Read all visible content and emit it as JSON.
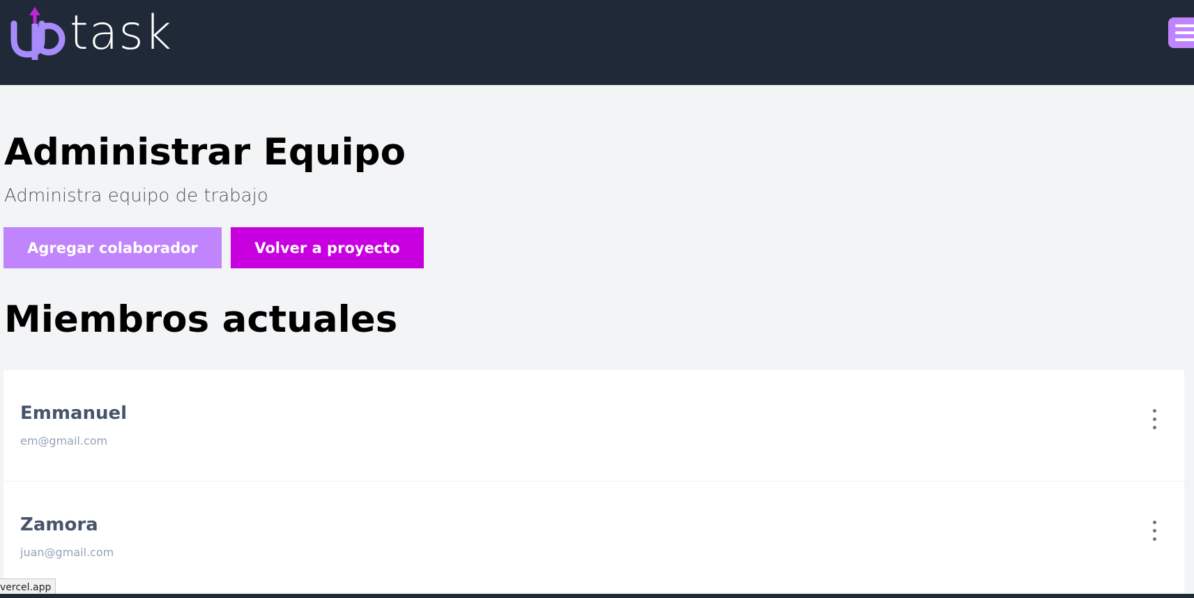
{
  "header": {
    "logo_text": "task",
    "logo_brand_colors": {
      "accent": "#a78bfa",
      "arrow": "#c026d3"
    },
    "menu_icon": "hamburger-menu-icon"
  },
  "main": {
    "title": "Administrar Equipo",
    "subtitle": "Administra equipo de trabajo",
    "buttons": {
      "add_collaborator": "Agregar colaborador",
      "back_to_project": "Volver a proyecto"
    },
    "section_title": "Miembros actuales",
    "members": [
      {
        "name": "Emmanuel",
        "email": "em@gmail.com",
        "actions_icon": "more-vertical-icon"
      },
      {
        "name": "Zamora",
        "email": "juan@gmail.com",
        "actions_icon": "more-vertical-icon"
      }
    ]
  },
  "status_bar": {
    "url_text": "vercel.app"
  },
  "colors": {
    "header_bg": "#1f2937",
    "page_bg": "#f3f4f6",
    "btn_add_bg": "#c084fc",
    "btn_back_bg": "#c800e0"
  }
}
